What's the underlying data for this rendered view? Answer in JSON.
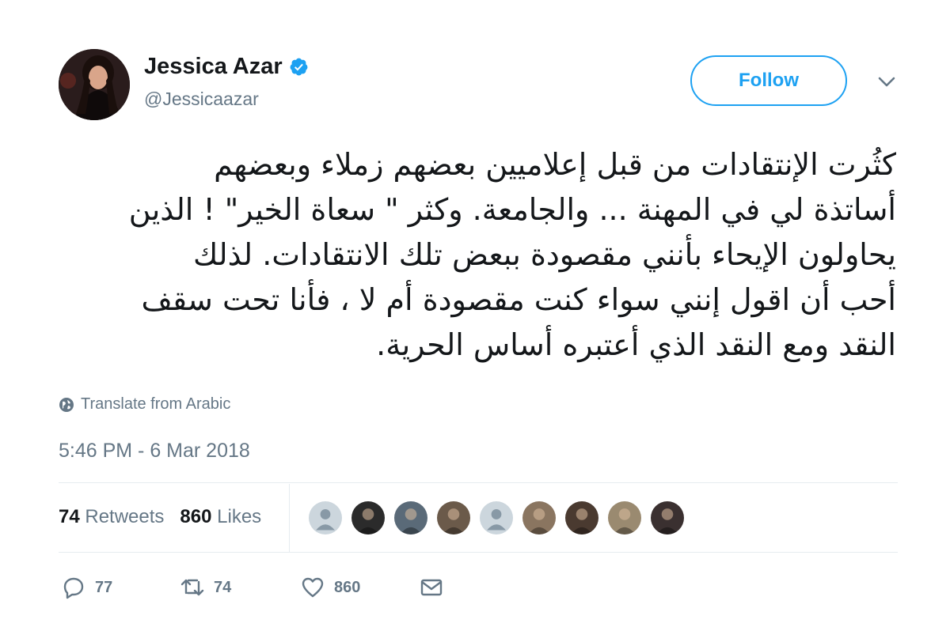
{
  "user": {
    "name": "Jessica Azar",
    "handle": "@Jessicaazar",
    "verified": true
  },
  "follow_label": "Follow",
  "tweet": {
    "lines": [
      "كثُرت الإنتقادات من قبل إعلاميين بعضهم زملاء وبعضهم",
      "أساتذة لي في المهنة ... والجامعة. وكثر \" سعاة الخير\" ! الذين",
      "يحاولون الإيحاء بأنني مقصودة ببعض تلك الانتقادات. لذلك",
      "أحب أن اقول إنني سواء كنت مقصودة أم لا ، فأنا تحت سقف",
      "النقد ومع النقد الذي أعتبره أساس الحرية."
    ]
  },
  "translate_label": "Translate from Arabic",
  "timestamp": "5:46 PM - 6 Mar 2018",
  "stats": {
    "retweets_count": "74",
    "retweets_label": "Retweets",
    "likes_count": "860",
    "likes_label": "Likes"
  },
  "likers": [
    {
      "type": "default",
      "color": "#ccd6dd"
    },
    {
      "type": "photo",
      "color": "#2b2b2b"
    },
    {
      "type": "photo",
      "color": "#5a6a78"
    },
    {
      "type": "photo",
      "color": "#6b5a4a"
    },
    {
      "type": "default",
      "color": "#ccd6dd"
    },
    {
      "type": "photo",
      "color": "#8a7560"
    },
    {
      "type": "photo",
      "color": "#4a3a30"
    },
    {
      "type": "photo",
      "color": "#9a8a70"
    },
    {
      "type": "photo",
      "color": "#3a3030"
    }
  ],
  "actions": {
    "reply_count": "77",
    "retweet_count": "74",
    "like_count": "860"
  },
  "colors": {
    "accent": "#1da1f2",
    "secondary_text": "#657786",
    "primary_text": "#14171a"
  }
}
